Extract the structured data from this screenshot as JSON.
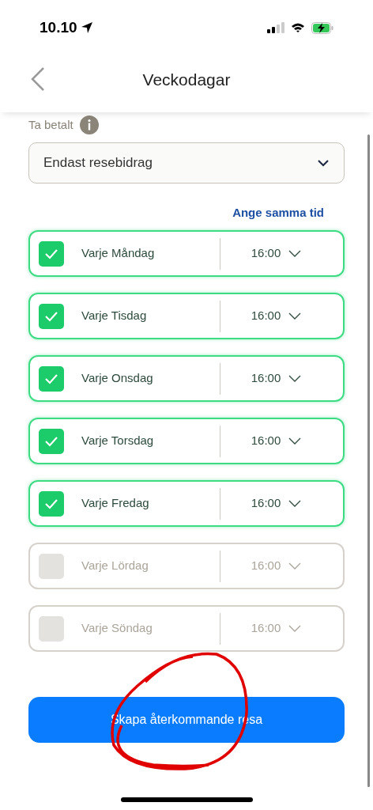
{
  "status_bar": {
    "time": "10.10"
  },
  "header": {
    "title": "Veckodagar"
  },
  "payment": {
    "label": "Ta betalt",
    "value": "Endast resebidrag"
  },
  "same_time_link": "Ange samma tid",
  "days": [
    {
      "label": "Varje Måndag",
      "time": "16:00",
      "checked": true
    },
    {
      "label": "Varje Tisdag",
      "time": "16:00",
      "checked": true
    },
    {
      "label": "Varje Onsdag",
      "time": "16:00",
      "checked": true
    },
    {
      "label": "Varje Torsdag",
      "time": "16:00",
      "checked": true
    },
    {
      "label": "Varje Fredag",
      "time": "16:00",
      "checked": true
    },
    {
      "label": "Varje Lördag",
      "time": "16:00",
      "checked": false
    },
    {
      "label": "Varje Söndag",
      "time": "16:00",
      "checked": false
    }
  ],
  "primary_button": "Skapa återkommande resa"
}
